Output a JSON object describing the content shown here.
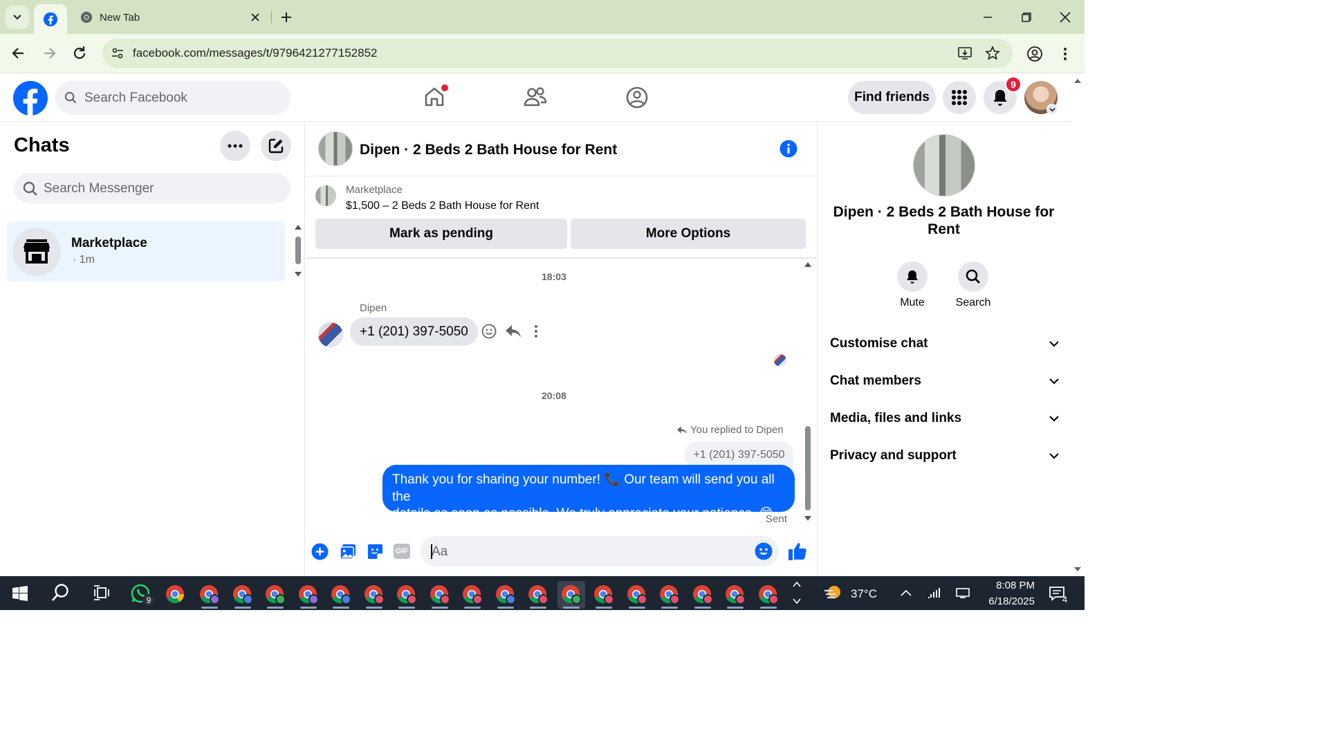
{
  "browser": {
    "tabs": [
      {
        "title": "",
        "icon": "facebook-icon",
        "active": true
      },
      {
        "title": "New Tab",
        "icon": "chrome-icon",
        "active": false
      }
    ],
    "url": "facebook.com/messages/t/9796421277152852"
  },
  "fb": {
    "search_placeholder": "Search Facebook",
    "find_friends": "Find friends",
    "notification_count": "9",
    "brand_color": "#0866ff"
  },
  "chats": {
    "title": "Chats",
    "search_placeholder": "Search Messenger",
    "items": [
      {
        "name": "Marketplace",
        "time": "· 1m"
      }
    ]
  },
  "conversation": {
    "title": "Dipen · 2 Beds 2 Bath House for Rent",
    "listing": {
      "source": "Marketplace",
      "desc": "$1,500 – 2 Beds 2 Bath House for Rent"
    },
    "mark_pending": "Mark as pending",
    "more_options": "More Options",
    "time1": "18:03",
    "sender": "Dipen",
    "received": "+1 (201) 397-5050",
    "time2": "20:08",
    "replied_note": "You replied to Dipen",
    "quoted": "+1 (201) 397-5050",
    "sent_line1": "Thank you for sharing your number! 📞 Our team will send you all the",
    "sent_line2": "details as soon as possible. We truly appreciate your patience. 😊",
    "status": "Sent",
    "composer_placeholder": "Aa"
  },
  "details": {
    "name_line1": "Dipen · 2 Beds 2 Bath House for",
    "name_line2": "Rent",
    "mute": "Mute",
    "search": "Search",
    "sections": [
      "Customise chat",
      "Chat members",
      "Media, files and links",
      "Privacy and support"
    ]
  },
  "taskbar": {
    "whatsapp_badge": "9",
    "temperature": "37°C",
    "time": "8:08 PM",
    "date": "6/18/2025",
    "notif_count": "4"
  }
}
